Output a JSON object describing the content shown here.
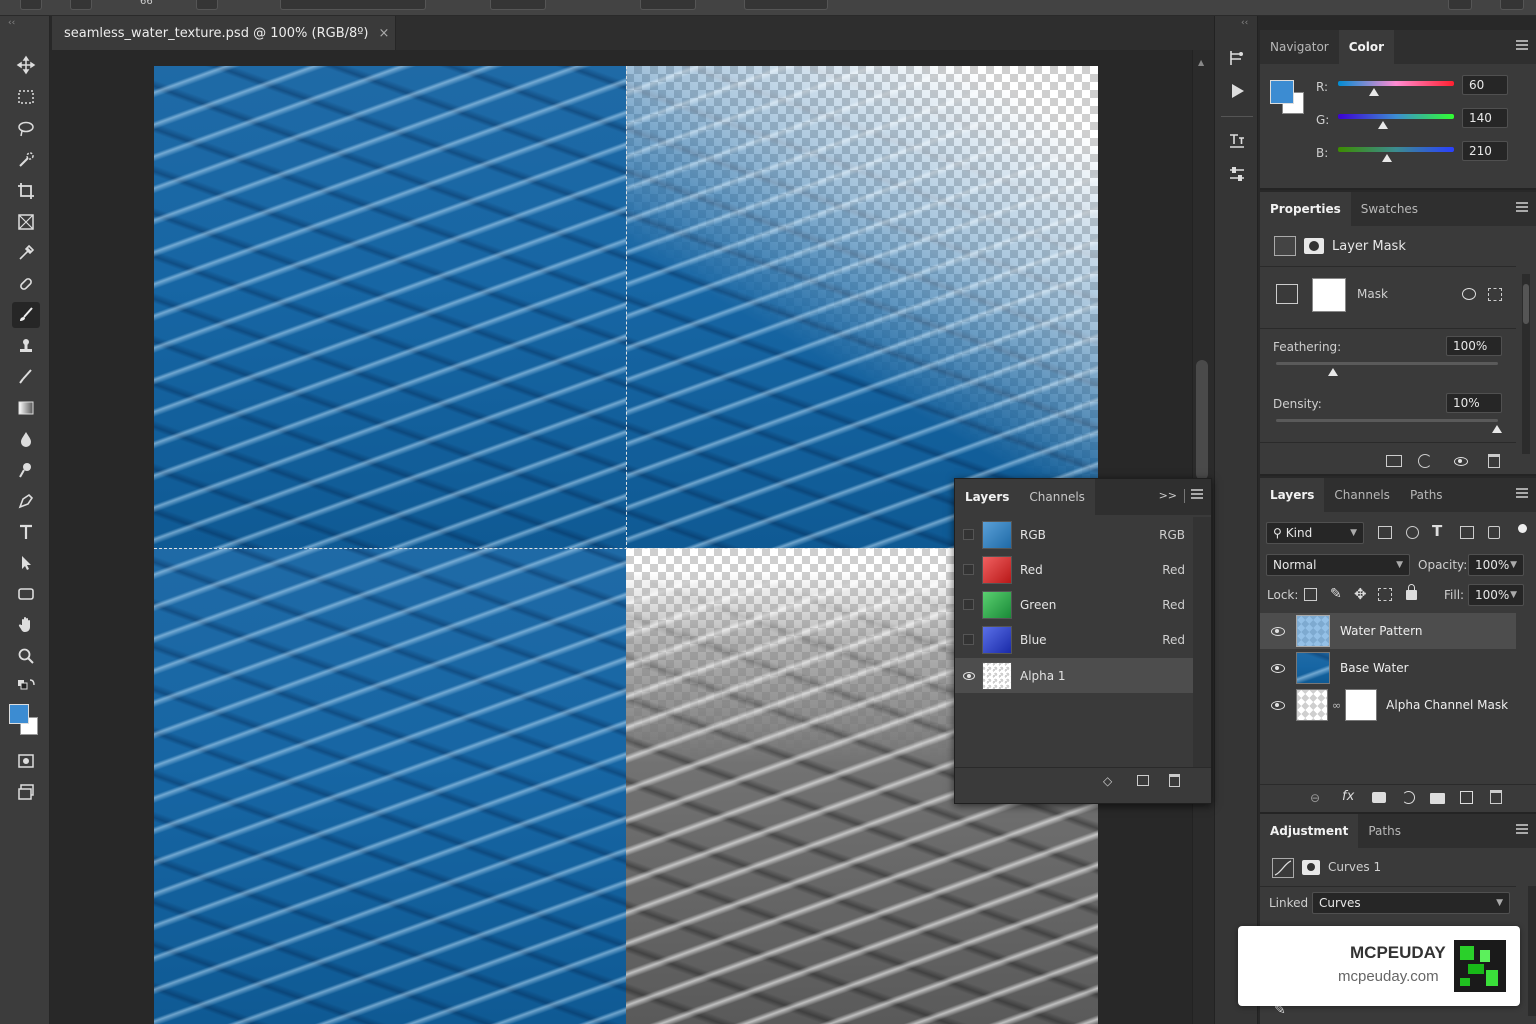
{
  "document": {
    "tab_title": "seamless_water_texture.psd @ 100% (RGB/8º)",
    "close_glyph": "×"
  },
  "optbar": {
    "zoom_text": "66"
  },
  "color_panel": {
    "tabs": [
      "Navigator",
      "Color"
    ],
    "active_tab": "Color",
    "r_label": "R:",
    "g_label": "G:",
    "b_label": "B:",
    "r_value": "60",
    "g_value": "140",
    "b_value": "210",
    "r": 60,
    "g": 140,
    "b": 210,
    "foreground_color": "#3c8cd2"
  },
  "properties_panel": {
    "tabs": [
      "Properties",
      "Swatches"
    ],
    "section_title": "Layer Mask",
    "mask_label": "Mask",
    "feathering_label": "Feathering:",
    "feathering_value": "100%",
    "density_label": "Density:",
    "density_value": "10%"
  },
  "layers_panel": {
    "tabs": [
      "Layers",
      "Channels",
      "Paths"
    ],
    "kind_filter": "Kind",
    "blend_mode": "Normal",
    "opacity_label": "Opacity:",
    "opacity_value": "100%",
    "lock_label": "Lock:",
    "fill_label": "Fill:",
    "fill_value": "100%",
    "layers": [
      {
        "name": "Water Pattern",
        "selected": true
      },
      {
        "name": "Base Water",
        "selected": false
      },
      {
        "name": "Alpha Channel Mask",
        "selected": false
      }
    ]
  },
  "channels_float": {
    "tabs": [
      "Layers",
      "Channels"
    ],
    "collapse_glyph": ">>",
    "channels": [
      {
        "name": "RGB",
        "shortcut": "RGB",
        "color": "#2a7bbf"
      },
      {
        "name": "Red",
        "shortcut": "Red",
        "color": "#d42a2a"
      },
      {
        "name": "Green",
        "shortcut": "Red",
        "color": "#2aa84a"
      },
      {
        "name": "Blue",
        "shortcut": "Red",
        "color": "#2a3fc4"
      },
      {
        "name": "Alpha 1",
        "shortcut": "",
        "color": "#dddddd"
      }
    ]
  },
  "adjustment_panel": {
    "tabs": [
      "Adjustment",
      "Paths"
    ],
    "layer_name": "Curves 1",
    "linked_label": "Linked",
    "linked_value": "Curves"
  },
  "watermark": {
    "brand": "MCPEUDAY",
    "url": "mcpeuday.com"
  }
}
